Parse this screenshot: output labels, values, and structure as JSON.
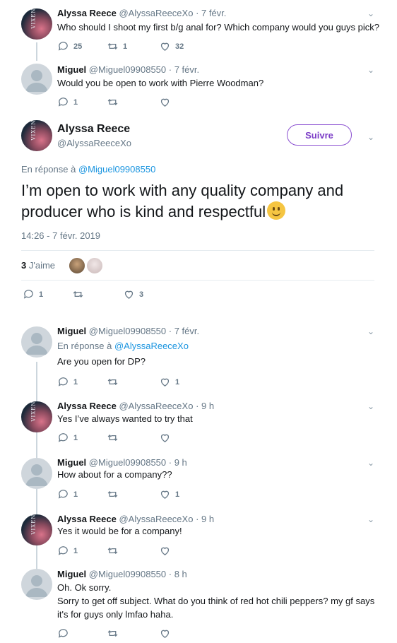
{
  "tweets": {
    "t1": {
      "name": "Alyssa Reece",
      "handle": "@AlyssaReeceXo",
      "time": "· 7 févr.",
      "text": "Who should I shoot my first b/g anal for? Which company would you guys pick?",
      "replies": "25",
      "retweets": "1",
      "likes": "32"
    },
    "t2": {
      "name": "Miguel",
      "handle": "@Miguel09908550",
      "time": "· 7 févr.",
      "text": "Would you be open to work with Pierre Woodman?",
      "replies": "1",
      "retweets": "",
      "likes": ""
    },
    "main": {
      "name": "Alyssa Reece",
      "handle": "@AlyssaReeceXo",
      "follow_label": "Suivre",
      "reply_prefix": "En réponse à",
      "reply_to": "@Miguel09908550",
      "text": "I’m open to work with any quality company and producer who is kind and respectful",
      "timestamp": "14:26 - 7 févr. 2019",
      "likes_count": "3",
      "likes_label": "J'aime",
      "replies": "1",
      "retweets": "",
      "likes": "3"
    },
    "t3": {
      "name": "Miguel",
      "handle": "@Miguel09908550",
      "time": "· 7 févr.",
      "reply_prefix": "En réponse à",
      "reply_to": "@AlyssaReeceXo",
      "text": "Are you open for DP?",
      "replies": "1",
      "retweets": "",
      "likes": "1"
    },
    "t4": {
      "name": "Alyssa Reece",
      "handle": "@AlyssaReeceXo",
      "time": "· 9 h",
      "text": "Yes I’ve always wanted to try that",
      "replies": "1",
      "retweets": "",
      "likes": ""
    },
    "t5": {
      "name": "Miguel",
      "handle": "@Miguel09908550",
      "time": "· 9 h",
      "text": "How about for a company??",
      "replies": "1",
      "retweets": "",
      "likes": "1"
    },
    "t6": {
      "name": "Alyssa Reece",
      "handle": "@AlyssaReeceXo",
      "time": "· 9 h",
      "text": "Yes it would be for a company!",
      "replies": "1",
      "retweets": "",
      "likes": ""
    },
    "t7": {
      "name": "Miguel",
      "handle": "@Miguel09908550",
      "time": "· 8 h",
      "text_line1": "Oh. Ok  sorry.",
      "text_line2": "Sorry to get off subject. What do you think of red hot chili peppers?  my gf says it's for guys only lmfao haha.",
      "replies": "",
      "retweets": "",
      "likes": ""
    }
  },
  "avatar_text": "VIXEN",
  "icons": {
    "reply": "reply-icon",
    "retweet": "retweet-icon",
    "like": "heart-icon",
    "more": "chevron-down-icon"
  },
  "colors": {
    "text": "#14171a",
    "muted": "#657786",
    "link": "#1b95e0",
    "follow": "#7c3ec7",
    "thread": "#ccd6dd"
  }
}
